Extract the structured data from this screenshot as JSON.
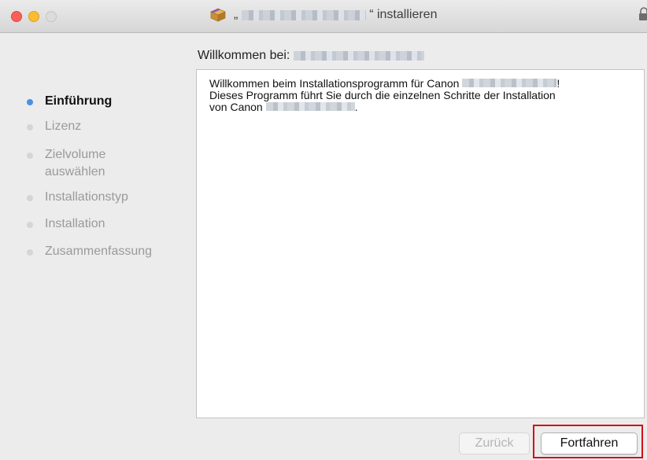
{
  "window": {
    "title_open_quote": "„",
    "title_suffix": "“ installieren",
    "title_redacted": true
  },
  "heading": {
    "label": "Willkommen bei:",
    "name_redacted": true
  },
  "steps": [
    {
      "label": "Einführung",
      "state": "active"
    },
    {
      "label": "Lizenz",
      "state": "inactive"
    },
    {
      "label": "Zielvolume auswählen",
      "state": "inactive"
    },
    {
      "label": "Installationstyp",
      "state": "inactive"
    },
    {
      "label": "Installation",
      "state": "inactive"
    },
    {
      "label": "Zusammenfassung",
      "state": "inactive"
    }
  ],
  "content": {
    "line1_prefix": "Willkommen beim Installationsprogramm für Canon",
    "line1_suffix": "!",
    "line2": "Dieses Programm führt Sie durch die einzelnen Schritte der Installation",
    "line3_prefix": "von Canon",
    "line3_suffix": "."
  },
  "buttons": {
    "back_label": "Zurück",
    "back_enabled": false,
    "continue_label": "Fortfahren",
    "continue_highlighted": true
  },
  "colors": {
    "active_step_dot": "#4a90e2",
    "highlight_border": "#d0101b",
    "close": "#fc5f57",
    "minimize": "#fdbc2e"
  },
  "icons": [
    "close-icon",
    "minimize-icon",
    "zoom-icon",
    "package-icon",
    "lock-icon"
  ]
}
